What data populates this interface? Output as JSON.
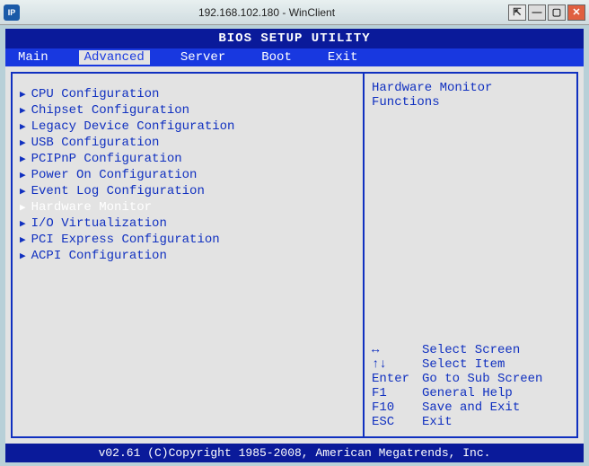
{
  "window": {
    "title": "192.168.102.180 - WinClient"
  },
  "bios": {
    "header": "BIOS SETUP UTILITY",
    "tabs": {
      "main": "Main",
      "advanced": "Advanced",
      "server": "Server",
      "boot": "Boot",
      "exit": "Exit"
    },
    "items": {
      "cpu": "CPU Configuration",
      "chipset": "Chipset Configuration",
      "legacy": "Legacy Device Configuration",
      "usb": "USB Configuration",
      "pcipnp": "PCIPnP Configuration",
      "poweron": "Power On Configuration",
      "eventlog": "Event Log Configuration",
      "hwmon": "Hardware Monitor",
      "iov": "I/O Virtualization",
      "pcie": "PCI Express Configuration",
      "acpi": "ACPI Configuration"
    },
    "help": {
      "title_line1": "Hardware Monitor",
      "title_line2": "Functions",
      "keys": {
        "lr": {
          "key": "↔",
          "label": "Select Screen"
        },
        "ud": {
          "key": "↑↓",
          "label": "Select Item"
        },
        "enter": {
          "key": "Enter",
          "label": "Go to Sub Screen"
        },
        "f1": {
          "key": "F1",
          "label": "General Help"
        },
        "f10": {
          "key": "F10",
          "label": "Save and Exit"
        },
        "esc": {
          "key": "ESC",
          "label": "Exit"
        }
      }
    },
    "footer": "v02.61 (C)Copyright 1985-2008, American Megatrends, Inc."
  }
}
